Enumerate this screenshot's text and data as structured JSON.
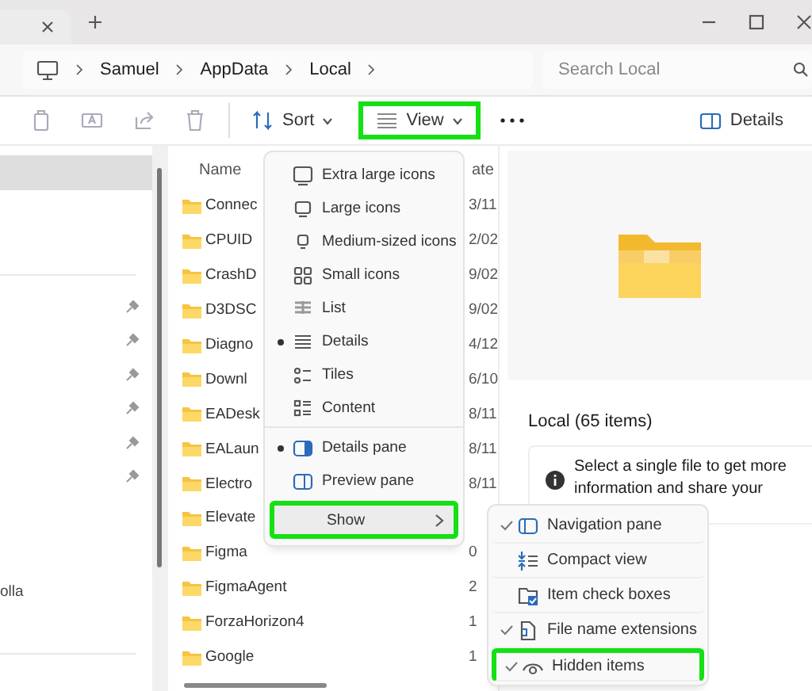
{
  "address_bar": {
    "breadcrumb": [
      "Samuel",
      "AppData",
      "Local"
    ]
  },
  "search": {
    "placeholder": "Search Local"
  },
  "toolbar": {
    "sort": {
      "label": "Sort"
    },
    "view": {
      "label": "View",
      "highlighted": true
    },
    "details": {
      "label": "Details"
    }
  },
  "sidebar": {
    "items": [
      {
        "label": "olla"
      }
    ]
  },
  "file_list": {
    "columns": [
      "Name",
      "ate"
    ],
    "rows": [
      {
        "name": "Connec",
        "date": "3/11"
      },
      {
        "name": "CPUID",
        "date": "2/02"
      },
      {
        "name": "CrashD",
        "date": "9/02"
      },
      {
        "name": "D3DSC",
        "date": "9/02"
      },
      {
        "name": "Diagno",
        "date": "4/12"
      },
      {
        "name": "Downl",
        "date": "6/10"
      },
      {
        "name": "EADesk",
        "date": "8/11"
      },
      {
        "name": "EALaun",
        "date": "8/11"
      },
      {
        "name": "Electro",
        "date": "8/11"
      },
      {
        "name": "Elevate",
        "date": ""
      },
      {
        "name": "Figma",
        "date": "0"
      },
      {
        "name": "FigmaAgent",
        "date": "2"
      },
      {
        "name": "ForzaHorizon4",
        "date": "1"
      },
      {
        "name": "Google",
        "date": "1"
      }
    ]
  },
  "view_menu": {
    "items": [
      {
        "kind": "option",
        "label": "Extra large icons",
        "selected": false,
        "highlighted": false
      },
      {
        "kind": "option",
        "label": "Large icons",
        "selected": false,
        "highlighted": false
      },
      {
        "kind": "option",
        "label": "Medium-sized icons",
        "selected": false,
        "highlighted": false
      },
      {
        "kind": "option",
        "label": "Small icons",
        "selected": false,
        "highlighted": false
      },
      {
        "kind": "option",
        "label": "List",
        "selected": false,
        "highlighted": false
      },
      {
        "kind": "option",
        "label": "Details",
        "selected": true,
        "highlighted": false
      },
      {
        "kind": "option",
        "label": "Tiles",
        "selected": false,
        "highlighted": false
      },
      {
        "kind": "option",
        "label": "Content",
        "selected": false,
        "highlighted": false
      },
      {
        "kind": "separator"
      },
      {
        "kind": "option",
        "label": "Details pane",
        "selected": true,
        "highlighted": false
      },
      {
        "kind": "option",
        "label": "Preview pane",
        "selected": false,
        "highlighted": false
      },
      {
        "kind": "submenu",
        "label": "Show",
        "selected": false,
        "highlighted": true
      }
    ]
  },
  "show_menu": {
    "items": [
      {
        "label": "Navigation pane",
        "checked": true,
        "highlighted": false
      },
      {
        "label": "Compact view",
        "checked": false,
        "highlighted": false
      },
      {
        "label": "Item check boxes",
        "checked": false,
        "highlighted": false
      },
      {
        "label": "File name extensions",
        "checked": true,
        "highlighted": false
      },
      {
        "label": "Hidden items",
        "checked": true,
        "highlighted": true
      }
    ]
  },
  "details_pane": {
    "title": "Local (65 items)",
    "info": "Select a single file to get more information and share your"
  }
}
